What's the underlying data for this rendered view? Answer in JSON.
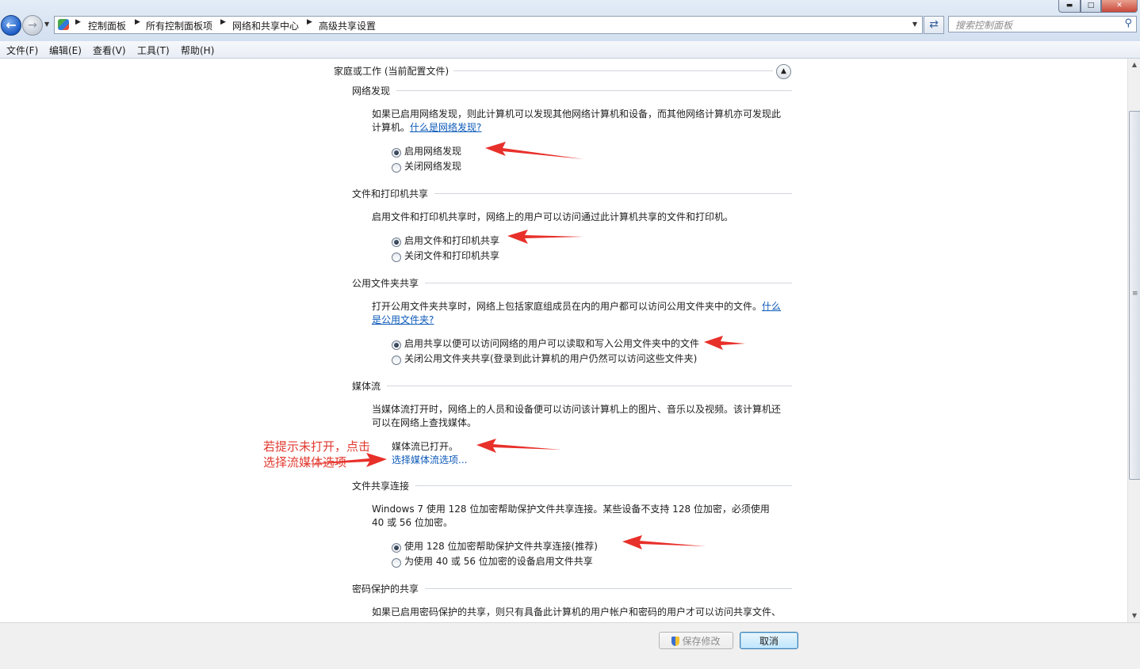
{
  "breadcrumb": [
    "控制面板",
    "所有控制面板项",
    "网络和共享中心",
    "高级共享设置"
  ],
  "search": {
    "placeholder": "搜索控制面板"
  },
  "menu": [
    "文件(F)",
    "编辑(E)",
    "查看(V)",
    "工具(T)",
    "帮助(H)"
  ],
  "profile": {
    "title": "家庭或工作 (当前配置文件)"
  },
  "sections": {
    "discovery": {
      "title": "网络发现",
      "desc": "如果已启用网络发现，则此计算机可以发现其他网络计算机和设备，而其他网络计算机亦可发现此计算机。",
      "link": "什么是网络发现?",
      "options": [
        "启用网络发现",
        "关闭网络发现"
      ],
      "selected": 0
    },
    "fileprint": {
      "title": "文件和打印机共享",
      "desc": "启用文件和打印机共享时，网络上的用户可以访问通过此计算机共享的文件和打印机。",
      "options": [
        "启用文件和打印机共享",
        "关闭文件和打印机共享"
      ],
      "selected": 0
    },
    "public": {
      "title": "公用文件夹共享",
      "desc": "打开公用文件夹共享时，网络上包括家庭组成员在内的用户都可以访问公用文件夹中的文件。",
      "link": "什么是公用文件夹?",
      "options": [
        "启用共享以便可以访问网络的用户可以读取和写入公用文件夹中的文件",
        "关闭公用文件夹共享(登录到此计算机的用户仍然可以访问这些文件夹)"
      ],
      "selected": 0
    },
    "media": {
      "title": "媒体流",
      "desc": "当媒体流打开时，网络上的人员和设备便可以访问该计算机上的图片、音乐以及视频。该计算机还可以在网络上查找媒体。",
      "status": "媒体流已打开。",
      "link": "选择媒体流选项..."
    },
    "connection": {
      "title": "文件共享连接",
      "desc": "Windows 7 使用 128 位加密帮助保护文件共享连接。某些设备不支持 128 位加密，必须使用 40 或 56 位加密。",
      "options": [
        "使用 128 位加密帮助保护文件共享连接(推荐)",
        "为使用 40 或 56 位加密的设备启用文件共享"
      ],
      "selected": 0
    },
    "password": {
      "title": "密码保护的共享",
      "desc": "如果已启用密码保护的共享，则只有具备此计算机的用户帐户和密码的用户才可以访问共享文件、"
    }
  },
  "annotation": {
    "line1": "若提示未打开，点击",
    "line2": "选择流媒体选项"
  },
  "buttons": {
    "save": "保存修改",
    "cancel": "取消"
  },
  "colors": {
    "annotation_red": "#e03a30",
    "link_blue": "#0b59b8",
    "arrow_red": "#e8302a"
  }
}
